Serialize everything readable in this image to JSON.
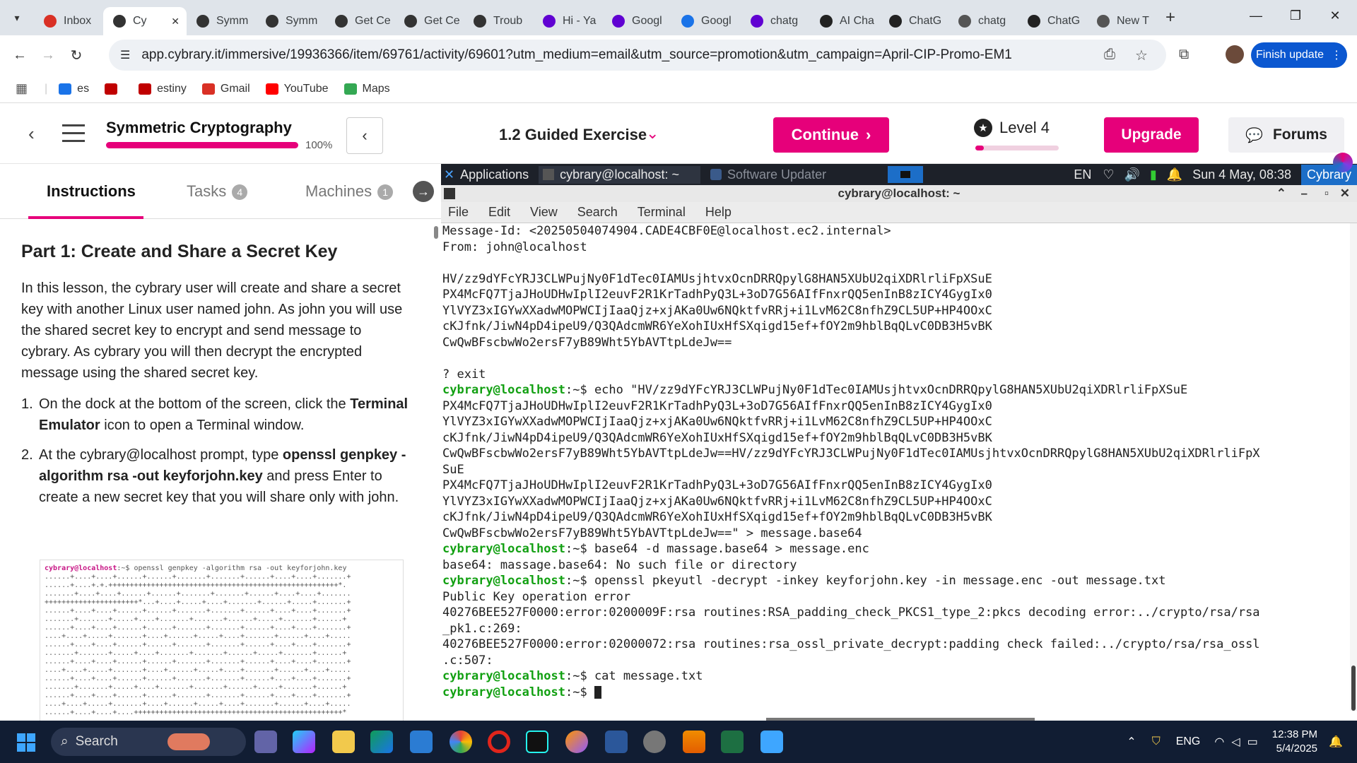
{
  "browser": {
    "tabs": [
      {
        "label": "Inbox",
        "icon": "gmail-icon",
        "color": "#d93025"
      },
      {
        "label": "Cy",
        "icon": "cybrary-icon",
        "color": "#333333",
        "active": true
      },
      {
        "label": "Symm",
        "icon": "cybrary-icon",
        "color": "#333333"
      },
      {
        "label": "Symm",
        "icon": "cybrary-icon",
        "color": "#333333"
      },
      {
        "label": "Get Ce",
        "icon": "cybrary-icon",
        "color": "#333333"
      },
      {
        "label": "Get Ce",
        "icon": "cybrary-icon",
        "color": "#333333"
      },
      {
        "label": "Troub",
        "icon": "cybrary-icon",
        "color": "#333333"
      },
      {
        "label": "Hi - Ya",
        "icon": "yahoo-icon",
        "color": "#6001d2"
      },
      {
        "label": "Googl",
        "icon": "yahoo-icon",
        "color": "#6001d2"
      },
      {
        "label": "Googl",
        "icon": "google-image-icon",
        "color": "#1a73e8"
      },
      {
        "label": "chatg",
        "icon": "yahoo-icon",
        "color": "#6001d2"
      },
      {
        "label": "AI Cha",
        "icon": "ai-chat-icon",
        "color": "#222222"
      },
      {
        "label": "ChatG",
        "icon": "openai-icon",
        "color": "#222222"
      },
      {
        "label": "chatg",
        "icon": "openai-icon",
        "color": "#555555"
      },
      {
        "label": "ChatG",
        "icon": "openai-icon",
        "color": "#222222"
      },
      {
        "label": "New T",
        "icon": "chrome-icon",
        "color": "#555555"
      }
    ],
    "url": "app.cybrary.it/immersive/19936366/item/69761/activity/69601?utm_medium=email&utm_source=promotion&utm_campaign=April-CIP-Promo-EM1",
    "finish_update": "Finish update",
    "bookmarks": [
      {
        "label": "es",
        "color": "#1a73e8"
      },
      {
        "label": "",
        "color": "#c00000"
      },
      {
        "label": "estiny",
        "color": "#c00000"
      },
      {
        "label": "Gmail",
        "color": "#d93025"
      },
      {
        "label": "YouTube",
        "color": "#ff0000"
      },
      {
        "label": "Maps",
        "color": "#34a853"
      }
    ]
  },
  "app": {
    "course_title": "Symmetric Cryptography",
    "progress_text": "100%",
    "progress": 1.0,
    "exercise": "1.2 Guided Exercise",
    "continue": "Continue",
    "level": "Level 4",
    "level_progress": 0.1,
    "upgrade": "Upgrade",
    "forums": "Forums",
    "accent": "#e6007a"
  },
  "left": {
    "tabs": [
      {
        "label": "Instructions"
      },
      {
        "label": "Tasks",
        "badge": "4"
      },
      {
        "label": "Machines",
        "badge": "1"
      }
    ],
    "heading": "Part 1: Create and Share a Secret Key",
    "intro": "In this lesson, the cybrary user will create and share a secret key with another Linux user named john. As john you will use the shared secret key to encrypt and send message to cybrary. As cybrary you will then decrypt the encrypted message using the shared secret key.",
    "step1_num": "1.",
    "step1_a": "On the dock at the bottom of the screen, click the ",
    "step1_b": "Terminal Emulator",
    "step1_c": " icon to open a Terminal window.",
    "step2_num": "2.",
    "step2_a": "At the cybrary@localhost prompt, type ",
    "step2_b": "openssl genpkey -algorithm rsa -out keyforjohn.key",
    "step2_c": " and press Enter to create a new secret key that you will share only with john.",
    "thumb_prompt": "cybrary@localhost",
    "thumb_cmd": ":~$ openssl genpkey -algorithm rsa -out keyforjohn.key",
    "thumb_lines": [
      "......+....+....+......+......+.......+.......+......+....+....+.......+",
      "......+....+.+.++++++++++++++++++++++++++++++++++++++++++++++++++++++*.",
      ".......+....+....+......+......+.......+.......+......+....+....+.......",
      "++++++++++++++++++++++*...+....+.....+....+.......+......+.....+.......+",
      "......+....+....+......+......+.......+.......+......+....+....+.......+",
      ".......+.......+.....+....+.......+.......+......+.....+.......+......+",
      "......+....+....+......+......+.......+.......+......+....+....+.......+",
      "....+....+.....+.......+....+......+.....+....+.......+......+....+.....",
      "......+....+....+......+......+.......+.......+......+....+....+.......+",
      ".......+.......+.....+....+.......+.......+......+.....+.......+......+",
      "......+....+....+......+......+.......+.......+......+....+....+.......+",
      "....+....+.....+.......+....+......+.....+....+.......+......+....+.....",
      "......+....+....+......+......+.......+.......+......+....+....+.......+",
      ".......+.......+.....+....+.......+.......+......+.....+.......+......+",
      "......+....+....+......+......+.......+.......+......+....+....+.......+",
      "....+....+.....+.......+....+......+.....+....+.......+......+....+.....",
      "......+....+....+....+++++++++++++++++++++++++++++++++++++++++++++++++*"
    ]
  },
  "desktop": {
    "panel": {
      "applications": "Applications",
      "terminal_task": "cybrary@localhost: ~",
      "updater_task": "Software Updater",
      "lang": "EN",
      "datetime": "Sun 4 May, 08:38",
      "user": "Cybrary"
    },
    "terminal": {
      "title": "cybrary@localhost: ~",
      "menu": [
        "File",
        "Edit",
        "View",
        "Search",
        "Terminal",
        "Help"
      ],
      "lines": [
        {
          "t": "Message-Id: <20250504074904.CADE4CBF0E@localhost.ec2.internal>"
        },
        {
          "t": "From: john@localhost"
        },
        {
          "t": ""
        },
        {
          "t": "HV/zz9dYFcYRJ3CLWPujNy0F1dTec0IAMUsjhtvxOcnDRRQpylG8HAN5XUbU2qiXDRlrliFpXSuE"
        },
        {
          "t": "PX4McFQ7TjaJHoUDHwIplI2euvF2R1KrTadhPyQ3L+3oD7G56AIfFnxrQQ5enInB8zICY4GygIx0"
        },
        {
          "t": "YlVYZ3xIGYwXXadwMOPWCIjIaaQjz+xjAKa0Uw6NQktfvRRj+i1LvM62C8nfhZ9CL5UP+HP4OOxC"
        },
        {
          "t": "cKJfnk/JiwN4pD4ipeU9/Q3QAdcmWR6YeXohIUxHfSXqigd15ef+fOY2m9hblBqQLvC0DB3H5vBK"
        },
        {
          "t": "CwQwBFscbwWo2ersF7yB89Wht5YbAVTtpLdeJw=="
        },
        {
          "t": ""
        },
        {
          "t": "? exit"
        },
        {
          "p": "cybrary@localhost",
          "t": ":~$ echo \"HV/zz9dYFcYRJ3CLWPujNy0F1dTec0IAMUsjhtvxOcnDRRQpylG8HAN5XUbU2qiXDRlrliFpXSuE"
        },
        {
          "t": "PX4McFQ7TjaJHoUDHwIplI2euvF2R1KrTadhPyQ3L+3oD7G56AIfFnxrQQ5enInB8zICY4GygIx0"
        },
        {
          "t": "YlVYZ3xIGYwXXadwMOPWCIjIaaQjz+xjAKa0Uw6NQktfvRRj+i1LvM62C8nfhZ9CL5UP+HP4OOxC"
        },
        {
          "t": "cKJfnk/JiwN4pD4ipeU9/Q3QAdcmWR6YeXohIUxHfSXqigd15ef+fOY2m9hblBqQLvC0DB3H5vBK"
        },
        {
          "t": "CwQwBFscbwWo2ersF7yB89Wht5YbAVTtpLdeJw==HV/zz9dYFcYRJ3CLWPujNy0F1dTec0IAMUsjhtvxOcnDRRQpylG8HAN5XUbU2qiXDRlrliFpX"
        },
        {
          "t": "SuE"
        },
        {
          "t": "PX4McFQ7TjaJHoUDHwIplI2euvF2R1KrTadhPyQ3L+3oD7G56AIfFnxrQQ5enInB8zICY4GygIx0"
        },
        {
          "t": "YlVYZ3xIGYwXXadwMOPWCIjIaaQjz+xjAKa0Uw6NQktfvRRj+i1LvM62C8nfhZ9CL5UP+HP4OOxC"
        },
        {
          "t": "cKJfnk/JiwN4pD4ipeU9/Q3QAdcmWR6YeXohIUxHfSXqigd15ef+fOY2m9hblBqQLvC0DB3H5vBK"
        },
        {
          "t": "CwQwBFscbwWo2ersF7yB89Wht5YbAVTtpLdeJw==\" > message.base64"
        },
        {
          "p": "cybrary@localhost",
          "t": ":~$ base64 -d massage.base64 > message.enc"
        },
        {
          "t": "base64: massage.base64: No such file or directory"
        },
        {
          "p": "cybrary@localhost",
          "t": ":~$ openssl pkeyutl -decrypt -inkey keyforjohn.key -in message.enc -out message.txt"
        },
        {
          "t": "Public Key operation error"
        },
        {
          "t": "40276BEE527F0000:error:0200009F:rsa routines:RSA_padding_check_PKCS1_type_2:pkcs decoding error:../crypto/rsa/rsa"
        },
        {
          "t": "_pk1.c:269:"
        },
        {
          "t": "40276BEE527F0000:error:02000072:rsa routines:rsa_ossl_private_decrypt:padding check failed:../crypto/rsa/rsa_ossl"
        },
        {
          "t": ".c:507:"
        },
        {
          "p": "cybrary@localhost",
          "t": ":~$ cat message.txt"
        },
        {
          "p": "cybrary@localhost",
          "t": ":~$ ",
          "cursor": true
        }
      ]
    }
  },
  "taskbar": {
    "search": "Search",
    "lang": "ENG",
    "time": "12:38 PM",
    "date": "5/4/2025"
  }
}
